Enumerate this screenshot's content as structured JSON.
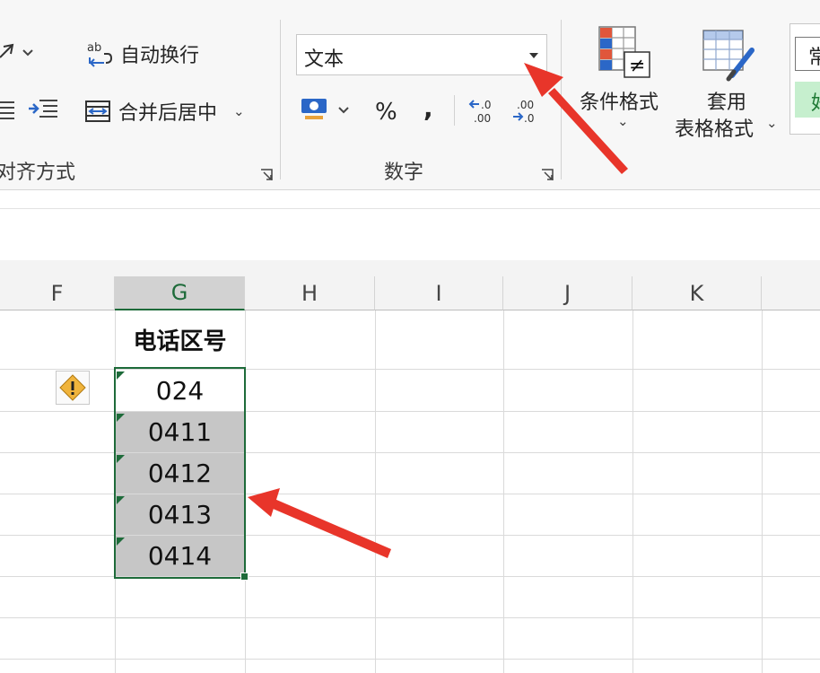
{
  "ribbon": {
    "alignment": {
      "wrap_text_label": "自动换行",
      "merge_center_label": "合并后居中",
      "group_label": "对齐方式"
    },
    "number": {
      "format_value": "文本",
      "percent_symbol": "%",
      "comma_symbol": ",",
      "group_label": "数字"
    },
    "styles": {
      "conditional_formatting_label": "条件格式",
      "format_as_table_label_line1": "套用",
      "format_as_table_label_line2": "表格格式",
      "cell_style_partial_top": "常",
      "cell_style_partial_bottom": "好"
    }
  },
  "grid": {
    "columns": [
      "F",
      "G",
      "H",
      "I",
      "J",
      "K"
    ],
    "selected_column": "G",
    "header_cell": "电话区号",
    "values": [
      "024",
      "0411",
      "0412",
      "0413",
      "0414"
    ]
  },
  "colors": {
    "accent_green": "#1e6b3a",
    "arrow_red": "#e8352a",
    "selection_gray": "#c6c6c6"
  }
}
